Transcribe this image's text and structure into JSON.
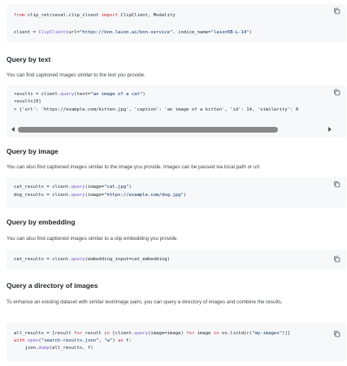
{
  "blocks": {
    "client": {
      "line1": {
        "kw1": "from",
        "mod": " clip_retrieval.clip_client ",
        "kw2": "import",
        "rest": " ClipClient, Modality"
      },
      "line2": {
        "pre": "client = ",
        "cls": "ClipClient",
        "open": "(url=",
        "url": "\"https://knn.laion.ai/knn-service\"",
        "mid": ", indice_name=",
        "idx": "\"laion5B-L-14\"",
        "close": ")"
      }
    },
    "text": {
      "line1": {
        "pre": "results = client.",
        "fn": "query",
        "open": "(text=",
        "arg": "\"an image of a cat\"",
        "close": ")"
      },
      "line2": "results[0]",
      "line3": "> {'url': 'https://example.com/kitten.jpg', 'caption': 'an image of a kitten', 'id': 14, 'similarity': 0"
    },
    "image": {
      "line1": {
        "pre": "cat_results = client.",
        "fn": "query",
        "open": "(image=",
        "arg": "\"cat.jpg\"",
        "close": ")"
      },
      "line2": {
        "pre": "dog_results = client.",
        "fn": "query",
        "open": "(image=",
        "arg": "\"https://example.com/dog.jpg\"",
        "close": ")"
      }
    },
    "embedding": {
      "line1": {
        "pre": "cat_results = client.",
        "fn": "query",
        "rest": "(embedding_input=cat_embedding)"
      }
    },
    "directory": {
      "line1": {
        "pre": "all_results = [result ",
        "kw1": "for",
        "a": " result ",
        "kw2": "in",
        "b": " [client.",
        "fn": "query",
        "c": "(image=image) ",
        "kw3": "for",
        "d": " image ",
        "kw4": "in",
        "e": " os.listdir(",
        "str": "\"my-images\"",
        "f": ")]]"
      },
      "line2": {
        "kw": "with",
        "sp": " ",
        "fn": "open",
        "open": "(",
        "s1": "\"search-results.json\"",
        "mid": ", ",
        "s2": "\"w\"",
        "close": ") ",
        "kw2": "as",
        "end": " f:"
      },
      "line3": {
        "pre": "    json.",
        "fn": "dump",
        "rest": "(all_results, f)"
      }
    }
  },
  "sections": {
    "text": {
      "title": "Query by text",
      "desc": "You can find captioned images similar to the text you provide."
    },
    "image": {
      "title": "Query by image",
      "desc": "You can also find captioned images similar to the image you provide. Images can be passed via local path or url."
    },
    "embedding": {
      "title": "Query by embedding",
      "desc": "You can also find captioned images similar to a clip embedding you provide."
    },
    "directory": {
      "title": "Query a directory of images",
      "desc": "To enhance an existing dataset with similar text/image pairs, you can query a directory of images and combine the results."
    }
  },
  "icons": {
    "copy": "copy-icon",
    "scroll_left": "arrow-left-icon",
    "scroll_right": "arrow-right-icon"
  },
  "colors": {
    "keyword": "#cf222e",
    "function": "#8250df",
    "string": "#0a3069",
    "code_bg": "#f6f8fa"
  }
}
